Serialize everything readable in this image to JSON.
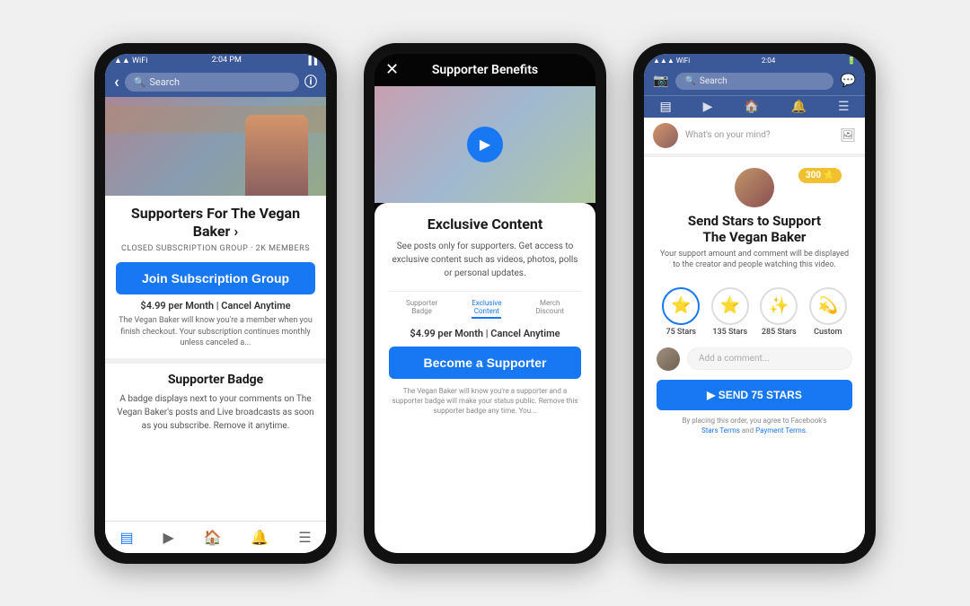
{
  "phone1": {
    "statusBar": {
      "time": "2:04 PM",
      "signal": "▲▲▲",
      "wifi": "WiFi",
      "battery": "█"
    },
    "header": {
      "backLabel": "‹",
      "searchPlaceholder": "Search",
      "infoLabel": "ⓘ"
    },
    "groupTitle": "Supporters For\nThe Vegan Baker ›",
    "groupSubtitle": "CLOSED SUBSCRIPTION GROUP · 2K MEMBERS",
    "joinButton": "Join Subscription Group",
    "priceLine": "$4.99 per Month  |  Cancel Anytime",
    "priceNote": "The Vegan Baker will know you're a member when you finish checkout. Your subscription continues monthly unless canceled a...",
    "badgeTitle": "Supporter Badge",
    "badgeDesc": "A badge displays next to your comments on The Vegan Baker's posts and Live broadcasts as soon as you subscribe. Remove it anytime.",
    "navIcons": [
      "▤",
      "▶",
      "🏠",
      "🔔",
      "☰"
    ]
  },
  "phone2": {
    "topBar": {
      "closeLabel": "✕",
      "title": "Supporter Benefits"
    },
    "exclusive": {
      "icon": "▶",
      "title": "Exclusive Content",
      "description": "See posts only for supporters. Get access to exclusive content such as videos, photos, polls or personal updates."
    },
    "tabs": [
      {
        "label": "Supporter\nBadge",
        "active": false
      },
      {
        "label": "Exclusive\nContent",
        "active": true
      },
      {
        "label": "Merch\nDiscount",
        "active": false
      }
    ],
    "priceLine": "$4.99 per Month  |  Cancel Anytime",
    "supporterButton": "Become a Supporter",
    "disclaimer": "The Vegan Baker will know you're a supporter and a supporter badge will make your status public. Remove this supporter badge any time. You..."
  },
  "phone3": {
    "statusBar": {
      "leftIcons": "▲▲▲ WiFi",
      "time": "2:04",
      "rightIcons": "🔋"
    },
    "header": {
      "cameraIcon": "📷",
      "searchPlaceholder": "🔍 Search",
      "messengerIcon": "💬"
    },
    "navTabs": [
      "▤",
      "▶",
      "🏠",
      "🔔",
      "☰"
    ],
    "whatsOn": "What's on your mind?",
    "starsModal": {
      "starsBadge": "300 ⭐",
      "title": "Send Stars to Support\nThe Vegan Baker",
      "subtitle": "Your support amount and comment will be displayed to the creator and people watching this video.",
      "options": [
        {
          "label": "75 Stars",
          "stars": "⭐",
          "selected": true
        },
        {
          "label": "135 Stars",
          "stars": "⭐",
          "selected": false
        },
        {
          "label": "285 Stars",
          "stars": "✨",
          "selected": false
        },
        {
          "label": "Custom",
          "stars": "💫",
          "selected": false
        }
      ],
      "commentPlaceholder": "Add a comment...",
      "sendButton": "▶ SEND 75 STARS",
      "terms": "By placing this order, you agree to Facebook's",
      "termsLinks": "Stars Terms and Payment Terms."
    }
  }
}
